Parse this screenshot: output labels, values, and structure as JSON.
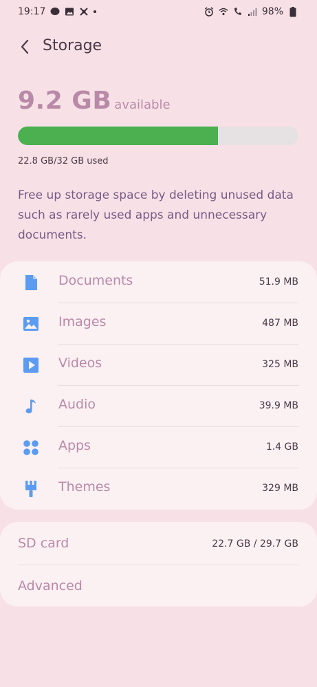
{
  "status": {
    "time": "19:17",
    "battery": "98%",
    "left_icons": [
      "line-icon",
      "image-icon",
      "sync-icon"
    ],
    "right_icons": [
      "alarm-icon",
      "wifi-icon",
      "call-icon",
      "signal-icon",
      "battery-icon"
    ]
  },
  "header": {
    "title": "Storage"
  },
  "storage": {
    "available_value": "9.2 GB",
    "available_label": "available",
    "used_text": "22.8 GB/32 GB used",
    "used_fraction": 0.7125,
    "bar_color": "#4caf50",
    "description": "Free up storage space by deleting unused data such as rarely used apps and unnecessary documents."
  },
  "categories": [
    {
      "label": "Documents",
      "size": "51.9 MB",
      "icon": "document-icon"
    },
    {
      "label": "Images",
      "size": "487 MB",
      "icon": "image-icon"
    },
    {
      "label": "Videos",
      "size": "325 MB",
      "icon": "video-icon"
    },
    {
      "label": "Audio",
      "size": "39.9 MB",
      "icon": "music-note-icon"
    },
    {
      "label": "Apps",
      "size": "1.4 GB",
      "icon": "apps-icon"
    },
    {
      "label": "Themes",
      "size": "329 MB",
      "icon": "brush-icon"
    }
  ],
  "sd": {
    "label": "SD card",
    "size": "22.7 GB / 29.7 GB"
  },
  "advanced": {
    "label": "Advanced"
  },
  "colors": {
    "accent_icon": "#5b9cf2",
    "label_color": "#b88aa8",
    "background": "#f7e1e6"
  }
}
